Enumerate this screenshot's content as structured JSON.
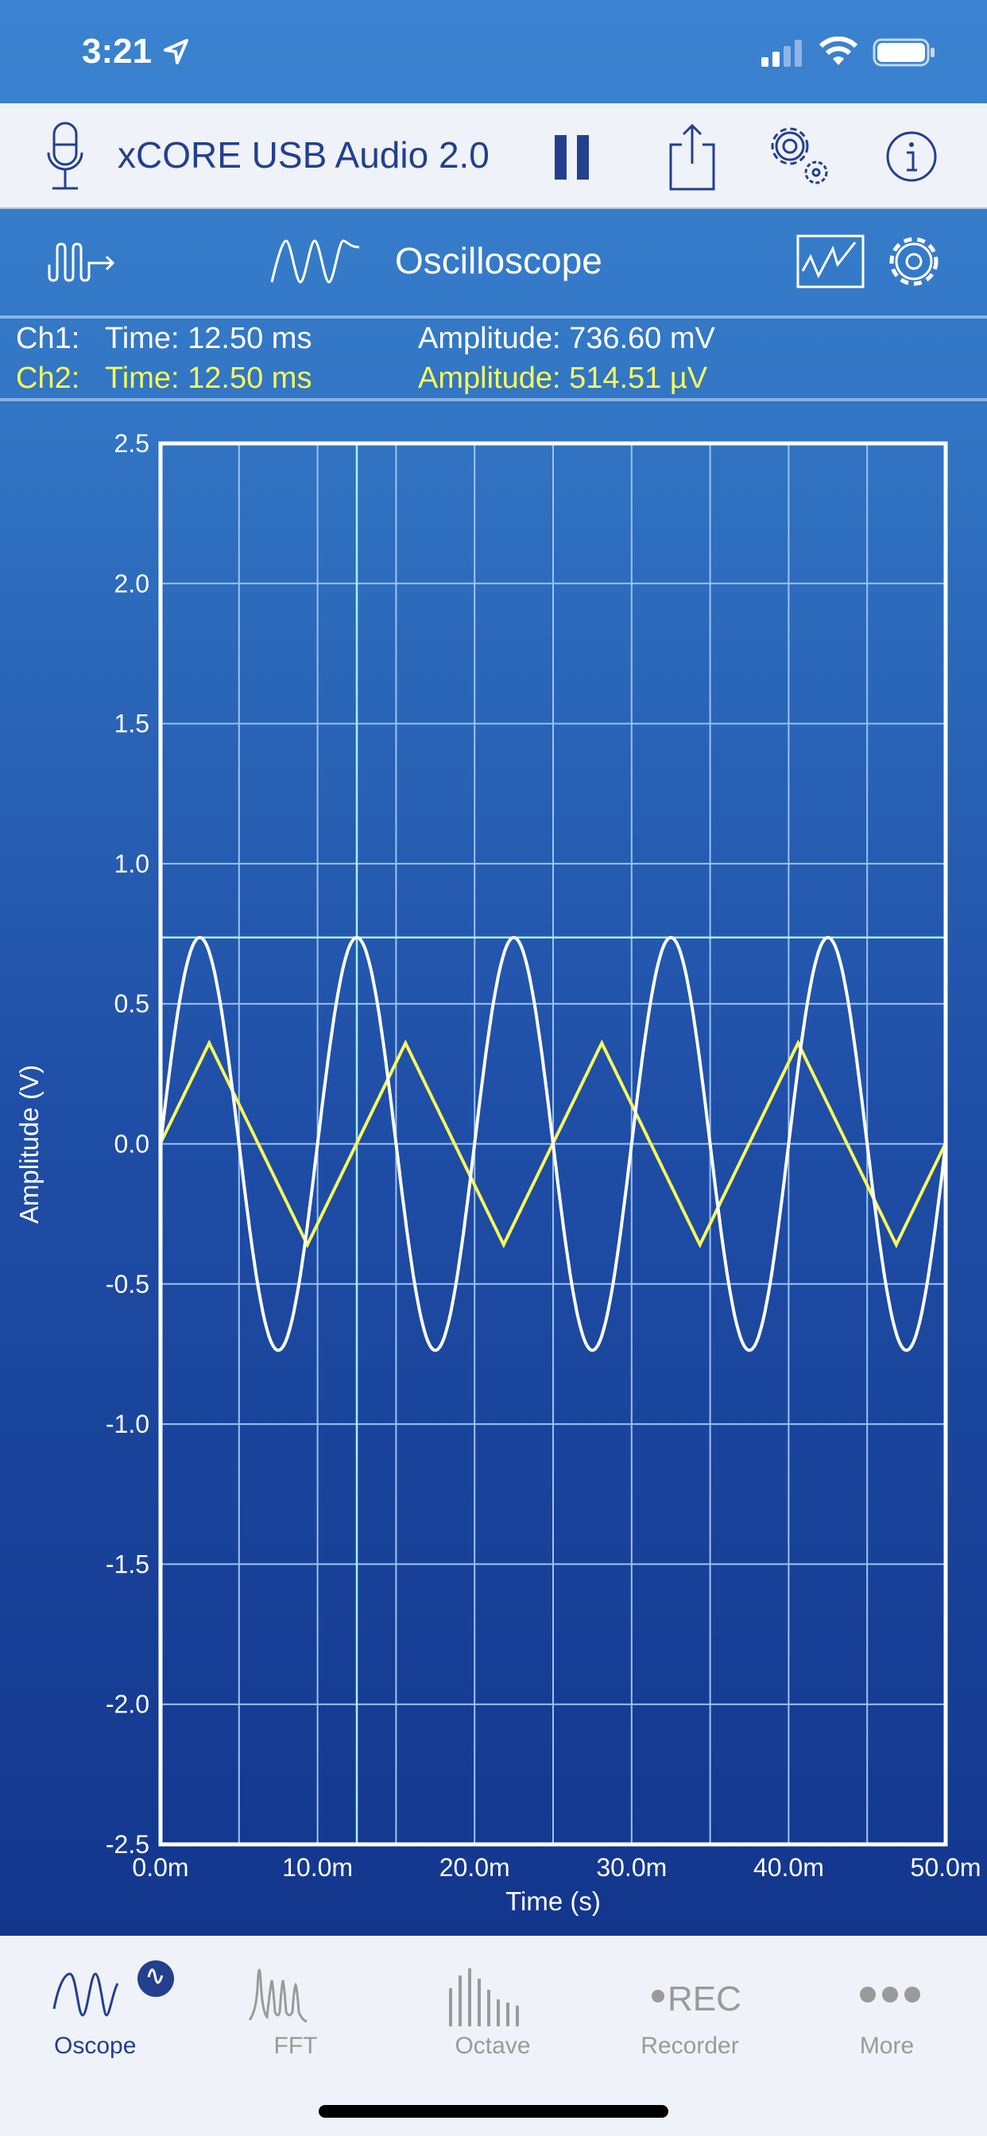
{
  "status_bar": {
    "time": "3:21",
    "icons": [
      "location-arrow-icon",
      "signal-icon",
      "wifi-icon",
      "battery-icon"
    ]
  },
  "header": {
    "device": "xCORE USB Audio 2.0",
    "icons": [
      "microphone-icon",
      "pause-icon",
      "share-icon",
      "settings-gears-icon",
      "info-icon"
    ]
  },
  "toolbar": {
    "mode": "Oscilloscope",
    "icons": [
      "signal-generator-icon",
      "sine-wave-icon",
      "trace-style-icon",
      "gear-icon"
    ]
  },
  "readout": {
    "ch1": {
      "label": "Ch1:",
      "time": "Time: 12.50 ms",
      "amplitude": "Amplitude: 736.60 mV"
    },
    "ch2": {
      "label": "Ch2:",
      "time": "Time: 12.50 ms",
      "amplitude": "Amplitude: 514.51 µV"
    }
  },
  "colors": {
    "ch1": "#ffffff",
    "ch2": "#f8f85a",
    "grid": "#9cc3f0",
    "cursor": "#a8f0f0",
    "accent": "#233f8e"
  },
  "chart_data": {
    "type": "line",
    "xlabel": "Time (s)",
    "ylabel": "Amplitude (V)",
    "xlim": [
      0,
      50
    ],
    "ylim": [
      -2.5,
      2.5
    ],
    "xticks": [
      "0.0m",
      "10.0m",
      "20.0m",
      "30.0m",
      "40.0m",
      "50.0m"
    ],
    "xtick_values": [
      0,
      10,
      20,
      30,
      40,
      50
    ],
    "yticks": [
      "2.5",
      "2.0",
      "1.5",
      "1.0",
      "0.5",
      "0.0",
      "-0.5",
      "-1.0",
      "-1.5",
      "-2.0",
      "-2.5"
    ],
    "ytick_values": [
      2.5,
      2.0,
      1.5,
      1.0,
      0.5,
      0.0,
      -0.5,
      -1.0,
      -1.5,
      -2.0,
      -2.5
    ],
    "grid": true,
    "cursor": {
      "time_ms": 12.5,
      "amplitude_v": 0.7366
    },
    "series": [
      {
        "channel": "Ch1",
        "shape": "sine",
        "amplitude_v": 0.7366,
        "period_ms": 10,
        "color": "#ffffff"
      },
      {
        "channel": "Ch2",
        "shape": "triangle",
        "amplitude_v": 0.36,
        "period_ms": 12.5,
        "first_peak_ms": 3.1,
        "color": "#f8f85a"
      }
    ]
  },
  "tabs": [
    {
      "label": "Oscope",
      "active": true
    },
    {
      "label": "FFT"
    },
    {
      "label": "Octave"
    },
    {
      "label": "Recorder"
    },
    {
      "label": "More"
    }
  ]
}
